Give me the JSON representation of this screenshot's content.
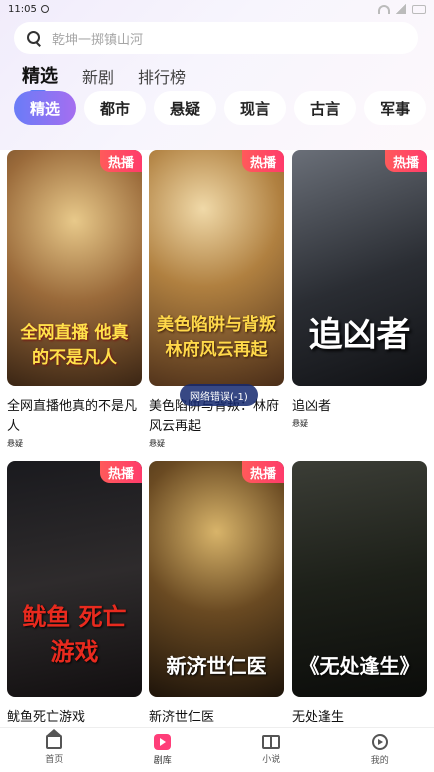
{
  "status_bar": {
    "time": "11:05"
  },
  "search": {
    "placeholder": "乾坤一掷镇山河"
  },
  "main_tabs": [
    {
      "label": "精选",
      "active": true
    },
    {
      "label": "新剧",
      "active": false
    },
    {
      "label": "排行榜",
      "active": false
    }
  ],
  "chips": [
    {
      "label": "精选",
      "active": true
    },
    {
      "label": "都市",
      "active": false
    },
    {
      "label": "悬疑",
      "active": false
    },
    {
      "label": "现言",
      "active": false
    },
    {
      "label": "古言",
      "active": false
    },
    {
      "label": "军事",
      "active": false
    }
  ],
  "cards": [
    {
      "title": "全网直播他真的不是凡人",
      "genre": "悬疑",
      "badge": "热播",
      "poster_text": "全网直播 他真的不是凡人"
    },
    {
      "title": "美色陷阱与背叛：林府风云再起",
      "genre": "悬疑",
      "badge": "热播",
      "poster_text": "美色陷阱与背叛 林府风云再起"
    },
    {
      "title": "追凶者",
      "genre": "悬疑",
      "badge": "热播",
      "poster_text": "追凶者"
    },
    {
      "title": "鱿鱼死亡游戏",
      "genre": "",
      "badge": "热播",
      "poster_text": "鱿鱼 死亡游戏"
    },
    {
      "title": "新济世仁医",
      "genre": "",
      "badge": "热播",
      "poster_text": "新济世仁医"
    },
    {
      "title": "无处逢生",
      "genre": "",
      "badge": "",
      "poster_text": "《无处逢生》"
    }
  ],
  "toast": "网络错误(-1)",
  "bottom_nav": [
    {
      "label": "首页",
      "icon": "home-icon",
      "active": false
    },
    {
      "label": "剧库",
      "icon": "drama-icon",
      "active": true
    },
    {
      "label": "小说",
      "icon": "book-icon",
      "active": false
    },
    {
      "label": "我的",
      "icon": "mine-icon",
      "active": false
    }
  ],
  "colors": {
    "accent": "#6a7cf7",
    "badge": "#ff4d64",
    "drama_pink": "#ff3e79"
  }
}
